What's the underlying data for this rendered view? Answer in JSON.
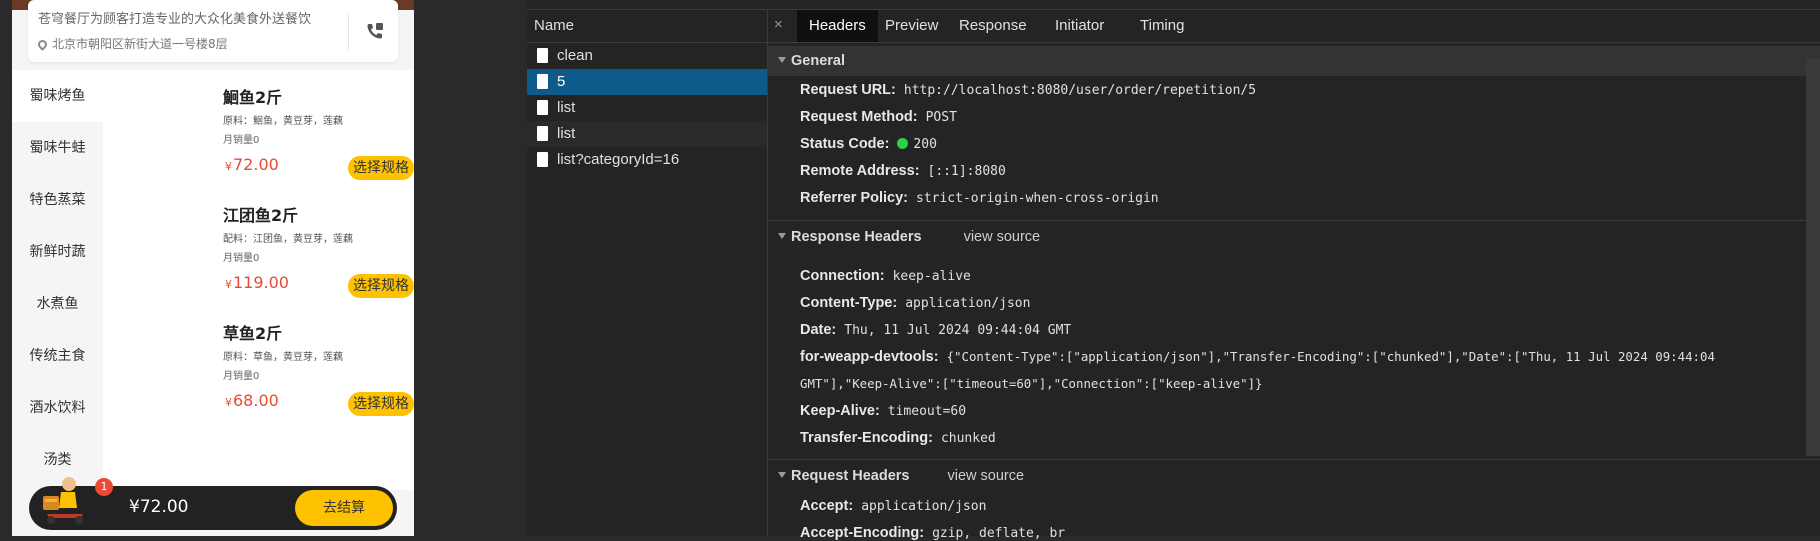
{
  "shop": {
    "description": "苍穹餐厅为顾客打造专业的大众化美食外送餐饮",
    "address": "北京市朝阳区新街大道一号楼8层"
  },
  "categories": [
    "蜀味烤鱼",
    "蜀味牛蛙",
    "特色蒸菜",
    "新鲜时蔬",
    "水煮鱼",
    "传统主食",
    "酒水饮料",
    "汤类"
  ],
  "dishes": [
    {
      "name": "鮰鱼2斤",
      "ingredients": "原料：鮰鱼，黄豆芽，莲藕",
      "sales": "月销量0",
      "currency": "¥",
      "price": "72.00",
      "button": "选择规格"
    },
    {
      "name": "江团鱼2斤",
      "ingredients": "配料：江团鱼，黄豆芽，莲藕",
      "sales": "月销量0",
      "currency": "¥",
      "price": "119.00",
      "button": "选择规格"
    },
    {
      "name": "草鱼2斤",
      "ingredients": "原料：草鱼，黄豆芽，莲藕",
      "sales": "月销量0",
      "currency": "¥",
      "price": "68.00",
      "button": "选择规格"
    }
  ],
  "cart": {
    "badge": "1",
    "total": "¥72.00",
    "checkout": "去结算"
  },
  "devtools": {
    "name_header": "Name",
    "requests": [
      "clean",
      "5",
      "list",
      "list",
      "list?categoryId=16"
    ],
    "selected_request": "5",
    "tabs": [
      "Headers",
      "Preview",
      "Response",
      "Initiator",
      "Timing"
    ],
    "active_tab": "Headers",
    "general": {
      "title": "General",
      "rows": [
        {
          "key": "Request URL:",
          "value": "http://localhost:8080/user/order/repetition/5"
        },
        {
          "key": "Request Method:",
          "value": "POST"
        },
        {
          "key": "Status Code:",
          "value": "200"
        },
        {
          "key": "Remote Address:",
          "value": "[::1]:8080"
        },
        {
          "key": "Referrer Policy:",
          "value": "strict-origin-when-cross-origin"
        }
      ]
    },
    "response_headers": {
      "title": "Response Headers",
      "view_source": "view source",
      "rows": [
        {
          "key": "Connection:",
          "value": "keep-alive"
        },
        {
          "key": "Content-Type:",
          "value": "application/json"
        },
        {
          "key": "Date:",
          "value": "Thu, 11 Jul 2024 09:44:04 GMT"
        },
        {
          "key": "for-weapp-devtools:",
          "value": "{\"Content-Type\":[\"application/json\"],\"Transfer-Encoding\":[\"chunked\"],\"Date\":[\"Thu, 11 Jul 2024 09:44:04",
          "continuation": "GMT\"],\"Keep-Alive\":[\"timeout=60\"],\"Connection\":[\"keep-alive\"]}"
        },
        {
          "key": "Keep-Alive:",
          "value": "timeout=60"
        },
        {
          "key": "Transfer-Encoding:",
          "value": "chunked"
        }
      ]
    },
    "request_headers": {
      "title": "Request Headers",
      "view_source": "view source",
      "rows": [
        {
          "key": "Accept:",
          "value": "application/json"
        },
        {
          "key": "Accept-Encoding:",
          "value": "gzip, deflate, br"
        }
      ]
    },
    "colors": {
      "selected_row": "#0e5a8a",
      "status_ok": "#2bd04a",
      "accent_yellow": "#ffc200",
      "price_red": "#e84a33"
    }
  }
}
